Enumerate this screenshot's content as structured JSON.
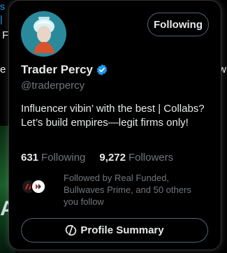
{
  "background": {
    "fragment_top_left": "s |",
    "fragment_fu": "Fu",
    "fragment_e": "e",
    "fragment_wh": "wh",
    "fragment_a": "A"
  },
  "card": {
    "avatar_icon": "profile-avatar",
    "follow_button_label": "Following",
    "display_name": "Trader Percy",
    "verified_icon": "verified-badge-icon",
    "handle": "@traderpercy",
    "bio": "Influencer vibin’ with the best | Collabs? Let’s build empires—legit firms only!",
    "stats": {
      "following_count": "631",
      "following_label": "Following",
      "followers_count": "9,272",
      "followers_label": "Followers"
    },
    "followed_by_text": "Followed by Real Funded, Bullwaves Prime, and 50 others you follow",
    "profile_summary_label": "Profile Summary",
    "profile_summary_icon": "summary-icon"
  },
  "colors": {
    "background": "#000000",
    "text_primary": "#e7e9ea",
    "text_secondary": "#71767b",
    "border": "#2f3336",
    "verified_blue": "#1d9bf0"
  }
}
